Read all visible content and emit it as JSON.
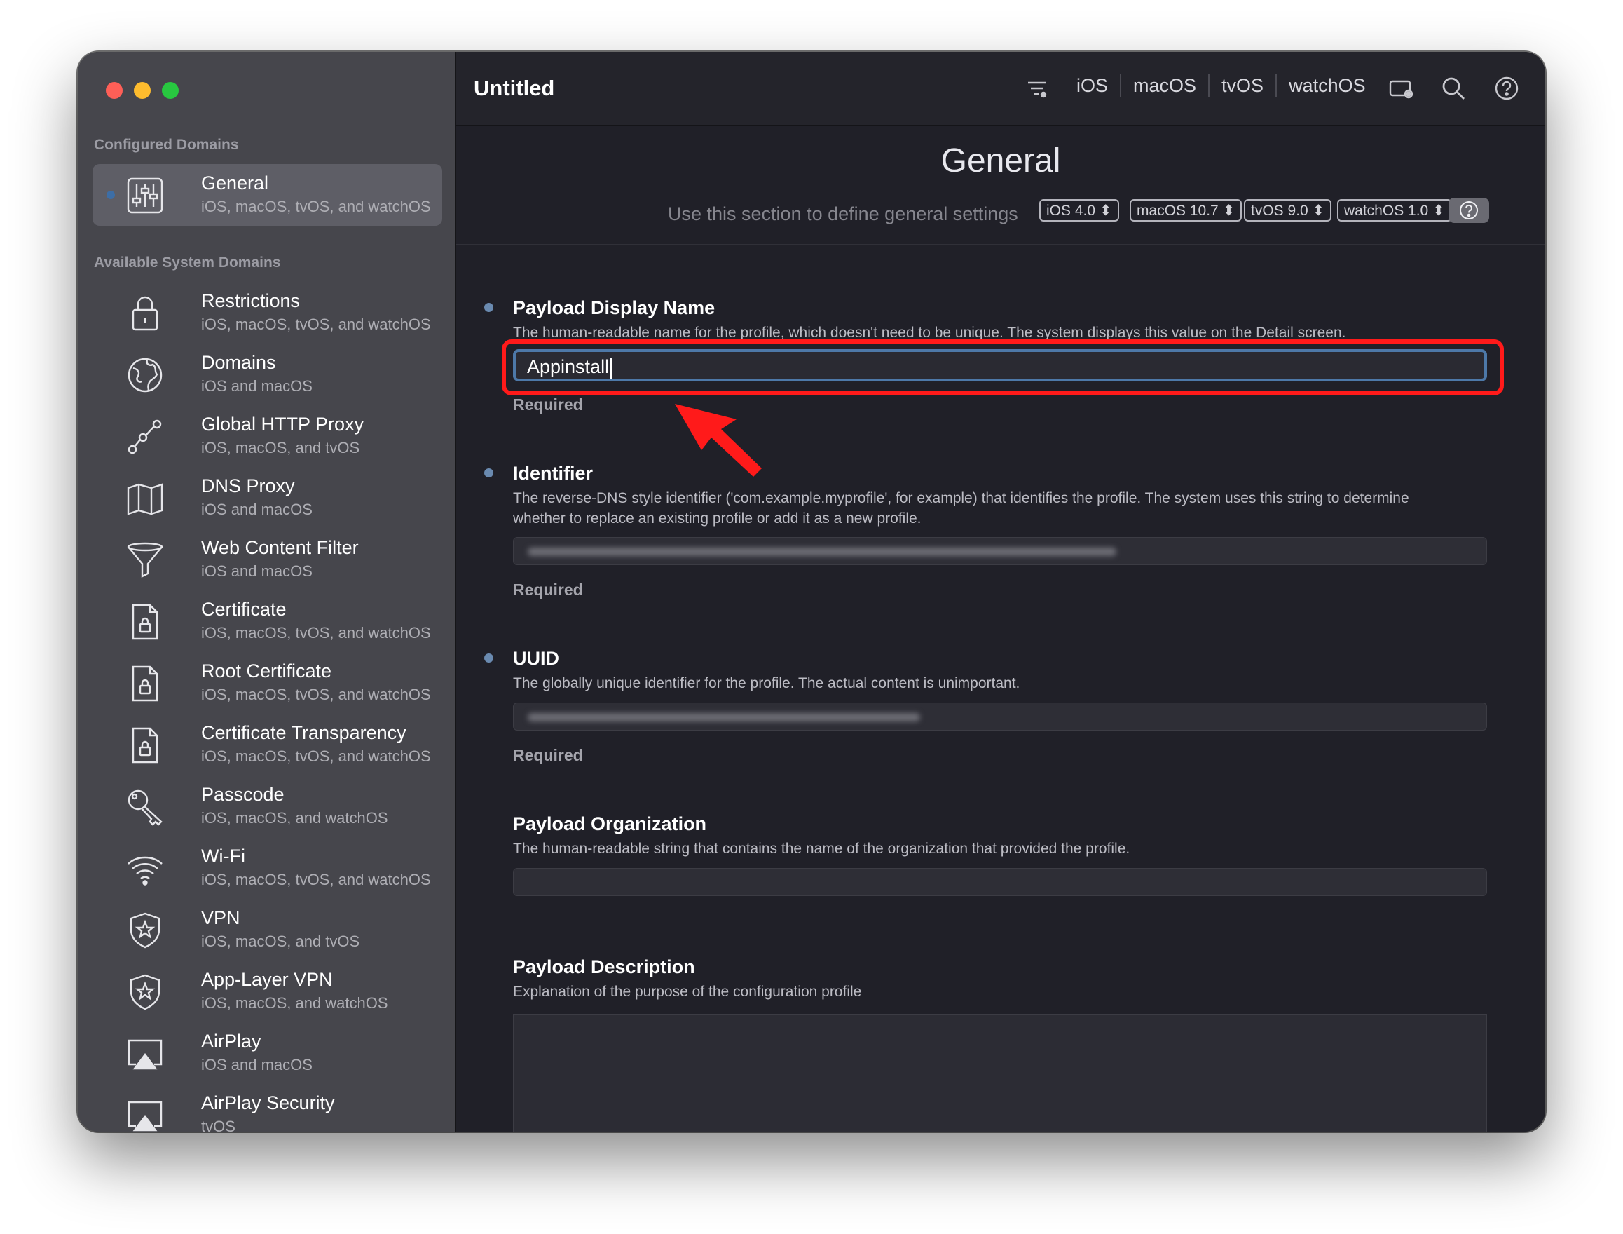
{
  "window": {
    "title": "Untitled"
  },
  "sidebar": {
    "configured_title": "Configured Domains",
    "configured": [
      {
        "label": "General",
        "platforms": "iOS, macOS, tvOS, and watchOS",
        "icon": "sliders-icon",
        "selected": true
      }
    ],
    "available_title": "Available System Domains",
    "items": [
      {
        "label": "Restrictions",
        "platforms": "iOS, macOS, tvOS, and watchOS",
        "icon": "padlock-icon"
      },
      {
        "label": "Domains",
        "platforms": "iOS and macOS",
        "icon": "globe-icon"
      },
      {
        "label": "Global HTTP Proxy",
        "platforms": "iOS, macOS, and tvOS",
        "icon": "proxy-network-icon"
      },
      {
        "label": "DNS Proxy",
        "platforms": "iOS and macOS",
        "icon": "map-icon"
      },
      {
        "label": "Web Content Filter",
        "platforms": "iOS and macOS",
        "icon": "funnel-icon"
      },
      {
        "label": "Certificate",
        "platforms": "iOS, macOS, tvOS, and watchOS",
        "icon": "certificate-lock-icon"
      },
      {
        "label": "Root Certificate",
        "platforms": "iOS, macOS, tvOS, and watchOS",
        "icon": "certificate-lock-icon"
      },
      {
        "label": "Certificate Transparency",
        "platforms": "iOS, macOS, tvOS, and watchOS",
        "icon": "certificate-lock-icon"
      },
      {
        "label": "Passcode",
        "platforms": "iOS, macOS, and watchOS",
        "icon": "key-icon"
      },
      {
        "label": "Wi-Fi",
        "platforms": "iOS, macOS, tvOS, and watchOS",
        "icon": "wifi-icon"
      },
      {
        "label": "VPN",
        "platforms": "iOS, macOS, and tvOS",
        "icon": "shield-star-icon"
      },
      {
        "label": "App-Layer VPN",
        "platforms": "iOS, macOS, and watchOS",
        "icon": "shield-star-icon"
      },
      {
        "label": "AirPlay",
        "platforms": "iOS and macOS",
        "icon": "airplay-icon"
      },
      {
        "label": "AirPlay Security",
        "platforms": "tvOS",
        "icon": "airplay-icon"
      }
    ]
  },
  "toolbar": {
    "platforms": [
      "iOS",
      "macOS",
      "tvOS",
      "watchOS"
    ],
    "icons": [
      "filter-icon",
      "device-settings-icon",
      "search-icon",
      "help-icon"
    ]
  },
  "header": {
    "title": "General",
    "description": "Use this section to define general settings",
    "versions": [
      "iOS  4.0",
      "macOS  10.7",
      "tvOS  9.0",
      "watchOS  1.0"
    ],
    "stepper_glyph": "⬍",
    "help_icon": "help-icon"
  },
  "fields": {
    "display_name": {
      "label": "Payload Display Name",
      "description": "The human-readable name for the profile, which doesn't need to be unique. The system displays this value on the Detail screen.",
      "value": "Appinstall",
      "required": "Required"
    },
    "identifier": {
      "label": "Identifier",
      "description": "The reverse-DNS style identifier ('com.example.myprofile', for example) that identifies the profile. The system uses this string to determine whether to replace an existing profile or add it as a new profile.",
      "required": "Required"
    },
    "uuid": {
      "label": "UUID",
      "description": "The globally unique identifier for the profile. The actual content is unimportant.",
      "required": "Required"
    },
    "organization": {
      "label": "Payload Organization",
      "description": "The human-readable string that contains the name of the organization that provided the profile."
    },
    "description": {
      "label": "Payload Description",
      "description": "Explanation of the purpose of the configuration profile"
    }
  },
  "colors": {
    "accent": "#4d78a8",
    "annotation": "#ff1a1a",
    "sidebar_bg": "#46464c",
    "main_bg": "#202028"
  }
}
